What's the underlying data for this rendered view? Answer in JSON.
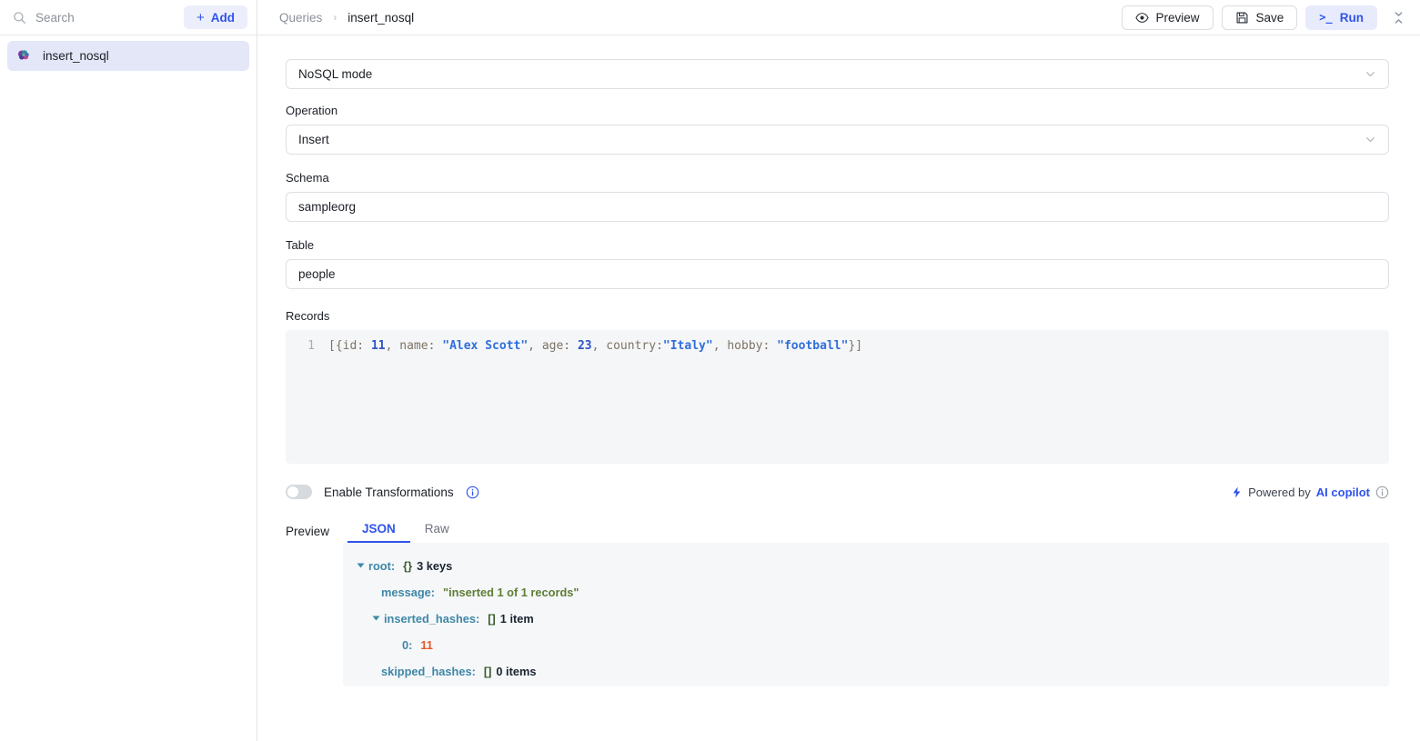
{
  "sidebar": {
    "search": {
      "placeholder": "Search",
      "value": "",
      "icon": "search-icon"
    },
    "add_button": {
      "label": "Add",
      "plus": "+"
    },
    "items": [
      {
        "label": "insert_nosql",
        "icon": "nosql-query-icon"
      }
    ]
  },
  "topbar": {
    "breadcrumb": {
      "root": "Queries",
      "separator": "›",
      "current": "insert_nosql"
    },
    "preview_button": "Preview",
    "save_button": "Save",
    "run_button": "Run",
    "run_prefix": ">_",
    "collapse_icon": "collapse-vertical-icon"
  },
  "form": {
    "mode": {
      "label": "",
      "value": "NoSQL mode"
    },
    "operation": {
      "label": "Operation",
      "value": "Insert"
    },
    "schema": {
      "label": "Schema",
      "value": "sampleorg"
    },
    "table": {
      "label": "Table",
      "value": "people"
    },
    "records": {
      "label": "Records",
      "line_number": "1",
      "tokens": [
        {
          "text": "[{id: ",
          "type": "punc"
        },
        {
          "text": "11",
          "type": "num"
        },
        {
          "text": ", name: ",
          "type": "punc"
        },
        {
          "text": "\"Alex Scott\"",
          "type": "str"
        },
        {
          "text": ", age: ",
          "type": "punc"
        },
        {
          "text": "23",
          "type": "num"
        },
        {
          "text": ", country:",
          "type": "punc"
        },
        {
          "text": "\"Italy\"",
          "type": "str"
        },
        {
          "text": ", hobby: ",
          "type": "punc"
        },
        {
          "text": "\"football\"",
          "type": "str"
        },
        {
          "text": "}]",
          "type": "punc"
        }
      ]
    }
  },
  "transformations": {
    "toggle_state": "off",
    "label": "Enable Transformations",
    "info_icon": "info-icon"
  },
  "copilot": {
    "bolt_icon": "lightning-bolt-icon",
    "prefix": "Powered by",
    "brand": "AI copilot",
    "info_icon": "info-icon"
  },
  "results": {
    "preview_label": "Preview",
    "tabs": [
      {
        "label": "JSON",
        "active": true
      },
      {
        "label": "Raw",
        "active": false
      }
    ],
    "json_tree": {
      "root_key": "root:",
      "root_type": "{}",
      "root_count": "3 keys",
      "message_key": "message:",
      "message_value": "\"inserted 1 of 1 records\"",
      "inserted_key": "inserted_hashes:",
      "inserted_type": "[]",
      "inserted_count": "1 item",
      "inserted_index": "0:",
      "inserted_value": "11",
      "skipped_key": "skipped_hashes:",
      "skipped_type": "[]",
      "skipped_count": "0 items"
    }
  },
  "colors": {
    "accent_blue": "#2f54eb",
    "accent_soft": "#e8ebfb",
    "sidebar_selected": "#e4e7f8",
    "border": "#dcdfe4",
    "editor_bg": "#f5f6f8",
    "json_bg": "#f5f7f9",
    "json_key": "#3f87a6",
    "json_string": "#5f7d36",
    "json_number": "#e8552c"
  }
}
